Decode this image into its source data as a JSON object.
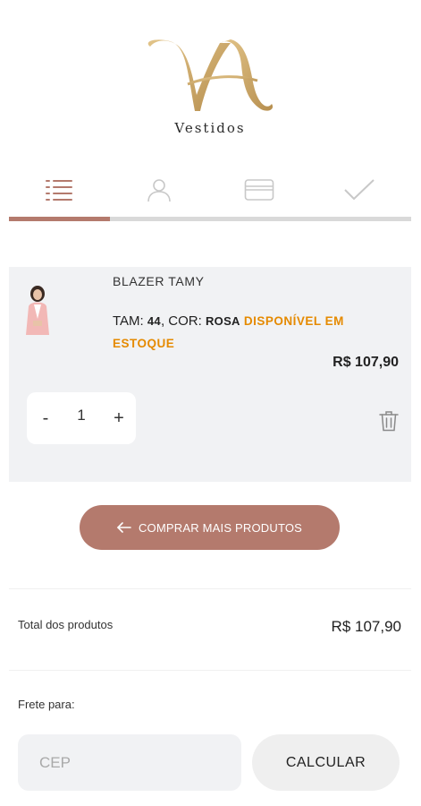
{
  "brand": {
    "sub": "Vestidos"
  },
  "steps": {
    "icons": [
      "list-icon",
      "user-icon",
      "card-icon",
      "check-icon"
    ],
    "progress_percent": 25,
    "active_color": "#b47a6d"
  },
  "cart": {
    "item": {
      "name": "BLAZER TAMY",
      "size_label": "TAM:",
      "size_value": "44",
      "color_label": ", COR:",
      "color_value": "ROSA",
      "stock": "DISPONÍVEL EM ESTOQUE",
      "price": "R$ 107,90",
      "quantity": "1",
      "minus": "-",
      "plus": "+"
    }
  },
  "more_button": {
    "label": "COMPRAR MAIS PRODUTOS"
  },
  "totals": {
    "label": "Total dos produtos",
    "value": "R$ 107,90"
  },
  "shipping": {
    "label": "Frete para:",
    "cep_placeholder": "CEP",
    "button": "CALCULAR"
  }
}
